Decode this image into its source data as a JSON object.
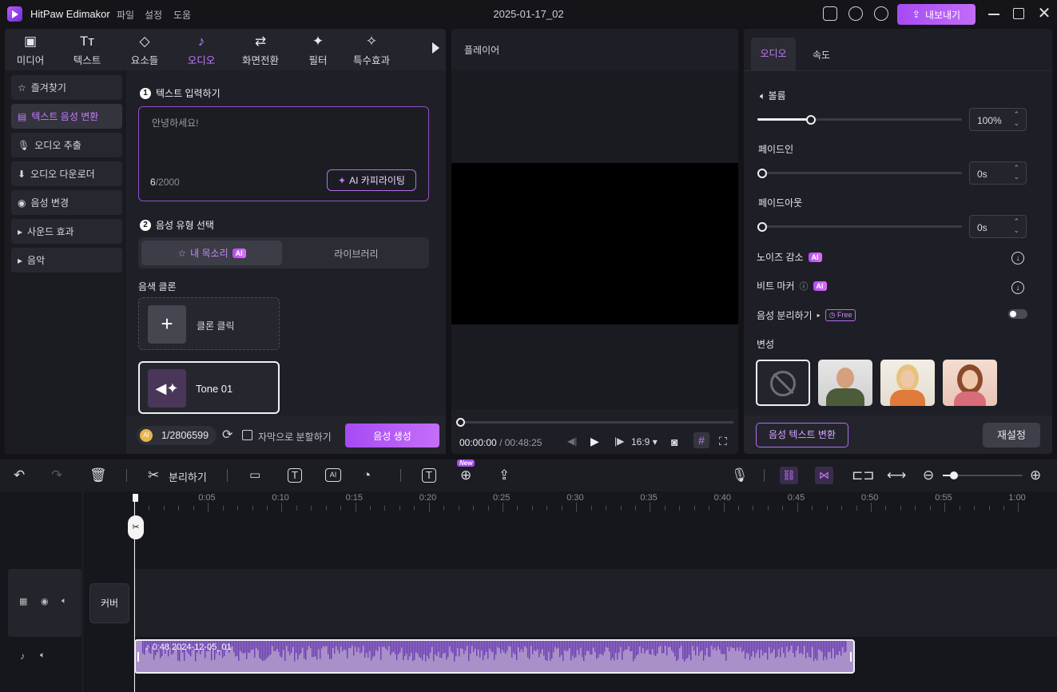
{
  "app": {
    "name": "HitPaw Edimakor",
    "menus": [
      "파일",
      "설정",
      "도움"
    ],
    "document_title": "2025-01-17_02",
    "export_label": "내보내기"
  },
  "tabs": [
    {
      "label": "미디어",
      "icon": "media-icon"
    },
    {
      "label": "텍스트",
      "icon": "text-icon"
    },
    {
      "label": "요소들",
      "icon": "elements-icon"
    },
    {
      "label": "오디오",
      "icon": "audio-icon",
      "active": true
    },
    {
      "label": "화면전환",
      "icon": "transition-icon"
    },
    {
      "label": "필터",
      "icon": "filter-icon"
    },
    {
      "label": "특수효과",
      "icon": "effects-icon"
    }
  ],
  "sidebar": {
    "items": [
      {
        "label": "즐겨찾기"
      },
      {
        "label": "텍스트 음성 변환",
        "active": true
      },
      {
        "label": "오디오 추출"
      },
      {
        "label": "오디오 다운로더"
      },
      {
        "label": "음성 변경"
      },
      {
        "label": "사운드 효과"
      },
      {
        "label": "음악"
      }
    ]
  },
  "tts": {
    "step1": "텍스트 입력하기",
    "placeholder": "안녕하세요!",
    "count": "6",
    "max": "/2000",
    "ai_copy": "AI 카피라이팅",
    "step2": "음성 유형 선택",
    "my_voice": "내 목소리",
    "ai_badge": "AI",
    "library": "라이브러리",
    "clone_heading": "음색 클론",
    "clone_click": "클론 클릭",
    "tone_name": "Tone 01",
    "credits": "1/2806599",
    "subtitle_split": "자막으로 분할하기",
    "generate": "음성 생성"
  },
  "player": {
    "title": "플레이어",
    "time_current": "00:00:00",
    "time_sep": "/",
    "time_total": "00:48:25",
    "ratio": "16:9"
  },
  "right": {
    "tab_audio": "오디오",
    "tab_speed": "속도",
    "volume_label": "볼륨",
    "volume_value": "100%",
    "volume_level": 0.26,
    "fadein_label": "페이드인",
    "fadein_value": "0s",
    "fadeout_label": "페이드아웃",
    "fadeout_value": "0s",
    "noise_label": "노이즈 감소",
    "beat_label": "비트 마커",
    "separate_label": "음성 분리하기",
    "free_badge": "Free",
    "voice_change_label": "변성",
    "tts_button": "음성 텍스트 변환",
    "reset_button": "재설정"
  },
  "toolbar": {
    "split_label": "분리하기",
    "new_badge": "New"
  },
  "timeline": {
    "ticks": [
      "0:05",
      "0:10",
      "0:15",
      "0:20",
      "0:25",
      "0:30",
      "0:35",
      "0:40",
      "0:45",
      "0:50",
      "0:55",
      "1:00"
    ],
    "cover_label": "커버",
    "clip_label": "0:48 2024-12-05_01"
  },
  "colors": {
    "accent": "#b660f6",
    "background": "#131318",
    "panel": "#1e1f26",
    "waveform": "#6b3fb0",
    "clip_bg": "#a990c9"
  }
}
